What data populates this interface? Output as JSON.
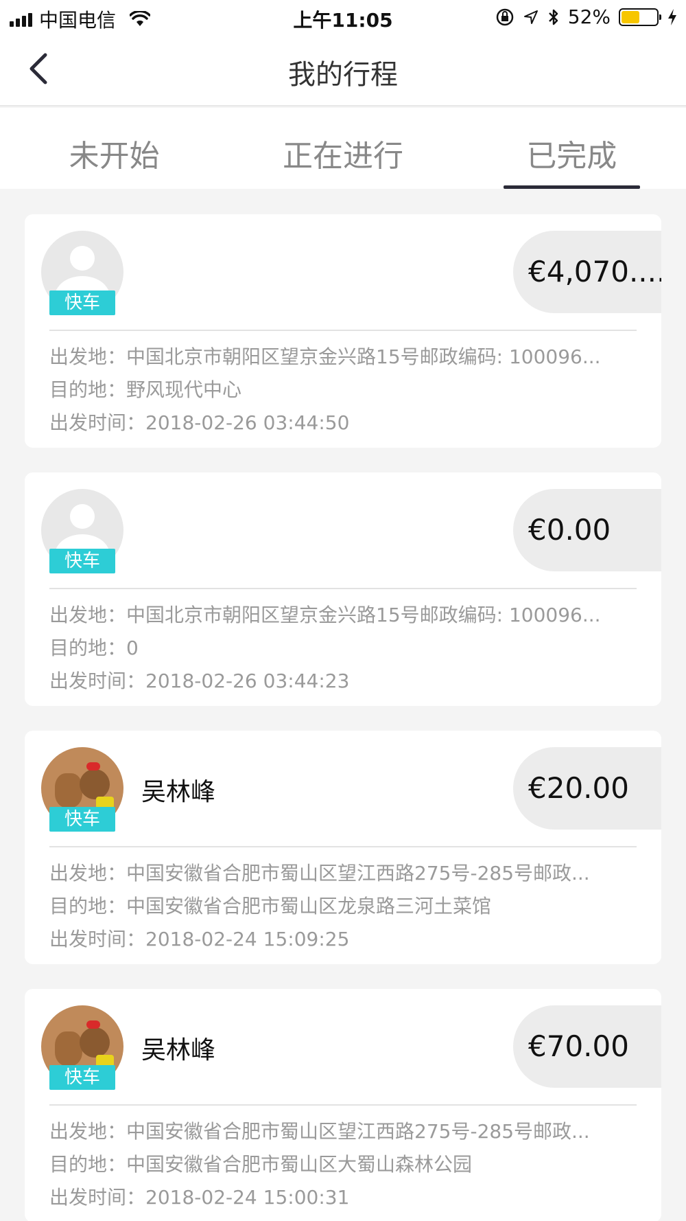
{
  "status_bar": {
    "carrier": "中国电信",
    "time": "上午11:05",
    "battery": "52%",
    "battery_level": 0.52
  },
  "nav": {
    "title": "我的行程"
  },
  "tabs": [
    {
      "label": "未开始",
      "active": false
    },
    {
      "label": "正在进行",
      "active": false
    },
    {
      "label": "已完成",
      "active": true
    }
  ],
  "trips": [
    {
      "tag": "快车",
      "driver": "",
      "price": "€4,070....",
      "origin_label": "出发地：",
      "origin": "中国北京市朝阳区望京金兴路15号邮政编码: 100096...",
      "destination_label": "目的地：",
      "destination": "野风现代中心",
      "time_label": "出发时间：",
      "time": "2018-02-26 03:44:50"
    },
    {
      "tag": "快车",
      "driver": "",
      "price": "€0.00",
      "origin_label": "出发地：",
      "origin": "中国北京市朝阳区望京金兴路15号邮政编码: 100096...",
      "destination_label": "目的地：",
      "destination": "0",
      "time_label": "出发时间：",
      "time": "2018-02-26 03:44:23"
    },
    {
      "tag": "快车",
      "driver": "吴林峰",
      "price": "€20.00",
      "origin_label": "出发地：",
      "origin": "中国安徽省合肥市蜀山区望江西路275号-285号邮政...",
      "destination_label": "目的地：",
      "destination": "中国安徽省合肥市蜀山区龙泉路三河土菜馆",
      "time_label": "出发时间：",
      "time": "2018-02-24 15:09:25"
    },
    {
      "tag": "快车",
      "driver": "吴林峰",
      "price": "€70.00",
      "origin_label": "出发地：",
      "origin": "中国安徽省合肥市蜀山区望江西路275号-285号邮政...",
      "destination_label": "目的地：",
      "destination": "中国安徽省合肥市蜀山区大蜀山森林公园",
      "time_label": "出发时间：",
      "time": "2018-02-24 15:00:31"
    }
  ],
  "colors": {
    "tag_bg": "#2dcdd6",
    "tab_indicator": "#2b2b38",
    "battery_fill": "#f7c600"
  }
}
